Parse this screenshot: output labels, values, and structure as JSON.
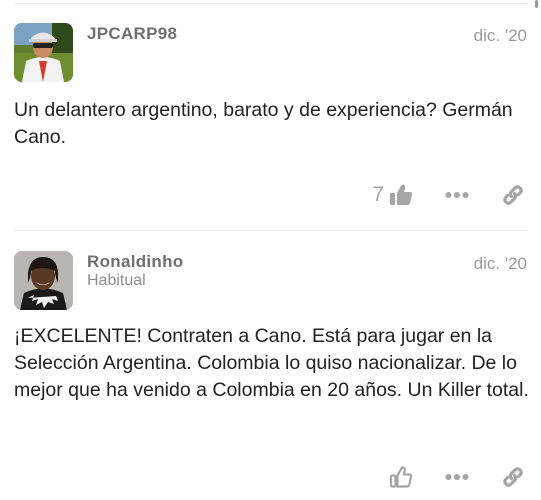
{
  "posts": [
    {
      "username": "JPCARP98",
      "user_title": "",
      "date": "dic. '20",
      "body": "Un delantero argentino, barato y de experiencia? Germán Cano.",
      "like_count": "7",
      "liked_icon": "thumbs-up-solid-icon"
    },
    {
      "username": "Ronaldinho",
      "user_title": "Habitual",
      "date": "dic. '20",
      "body": "¡EXCELENTE! Contraten a Cano. Está para jugar en la Selección Argentina. Colombia lo quiso nacionalizar. De lo mejor que ha venido a Colombia en 20 años. Un Killer total.",
      "like_count": "",
      "liked_icon": "thumbs-up-outline-icon"
    }
  ],
  "icons": {
    "more": "ellipsis-icon",
    "share": "link-icon"
  },
  "colors": {
    "icon_gray": "#a5a5a5",
    "divider": "#e9e9e9"
  }
}
